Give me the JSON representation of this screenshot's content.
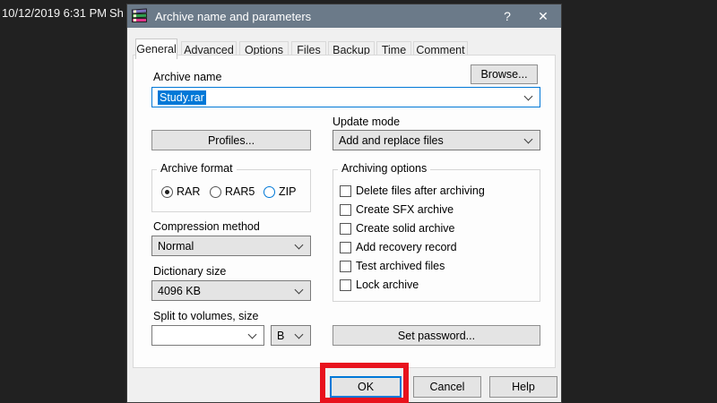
{
  "desktop": {
    "timestamp": "10/12/2019 6:31 PM",
    "partial_text": "Sh"
  },
  "dialog": {
    "title": "Archive name and parameters",
    "titlebar": {
      "help_glyph": "?",
      "close_glyph": "✕"
    },
    "tabs": [
      {
        "label": "General",
        "active": true
      },
      {
        "label": "Advanced",
        "active": false
      },
      {
        "label": "Options",
        "active": false
      },
      {
        "label": "Files",
        "active": false
      },
      {
        "label": "Backup",
        "active": false
      },
      {
        "label": "Time",
        "active": false
      },
      {
        "label": "Comment",
        "active": false
      }
    ],
    "general_tab": {
      "archive_name": {
        "label": "Archive name",
        "value": "Study.rar",
        "browse_label": "Browse..."
      },
      "profiles_label": "Profiles...",
      "update_mode": {
        "label": "Update mode",
        "value": "Add and replace files"
      },
      "archive_format": {
        "label": "Archive format",
        "options": [
          {
            "label": "RAR",
            "selected": true
          },
          {
            "label": "RAR5",
            "selected": false
          },
          {
            "label": "ZIP",
            "selected": false
          }
        ]
      },
      "archiving_options": {
        "label": "Archiving options",
        "items": [
          {
            "label": "Delete files after archiving",
            "checked": false
          },
          {
            "label": "Create SFX archive",
            "checked": false
          },
          {
            "label": "Create solid archive",
            "checked": false
          },
          {
            "label": "Add recovery record",
            "checked": false
          },
          {
            "label": "Test archived files",
            "checked": false
          },
          {
            "label": "Lock archive",
            "checked": false
          }
        ]
      },
      "compression": {
        "label": "Compression method",
        "value": "Normal"
      },
      "dictionary": {
        "label": "Dictionary size",
        "value": "4096 KB"
      },
      "split": {
        "label": "Split to volumes, size",
        "value": "",
        "unit": "B"
      },
      "set_password_label": "Set password..."
    },
    "footer": {
      "ok_label": "OK",
      "cancel_label": "Cancel",
      "help_label": "Help"
    },
    "colors": {
      "accent": "#0078d7",
      "titlebar": "#6b7a89",
      "annotation": "#e8121d",
      "selection": "#0078d7"
    }
  }
}
